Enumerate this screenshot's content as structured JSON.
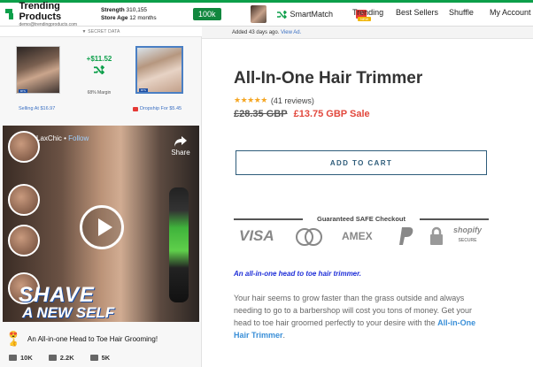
{
  "topbar": {
    "logo_title": "Trending Products",
    "logo_email": "demo@trendingproducts.com",
    "strength_label": "Strength",
    "strength_value": "310,155",
    "store_age_label": "Store Age",
    "store_age_value": "12 months",
    "score": "100k",
    "smartmatch_label": "SmartMatch",
    "notification_count": "6",
    "nav": [
      "Trending",
      "Best Sellers",
      "Shuffle",
      "My Account"
    ],
    "trending_badge": "NEW"
  },
  "left_panel": {
    "secret_label": "SECRET DATA",
    "margin_price": "+$11.52",
    "margin_pct": "68% Margin",
    "selling_label": "Selling At $16.97",
    "dropship_label": "Dropship For $5.45",
    "thumb_tag_1": "BTS",
    "thumb_tag_2": "BTS",
    "video": {
      "creator": "LaxChic",
      "follow": "Follow",
      "share": "Share",
      "headline_1": "SHAVE",
      "headline_2": "A NEW SELF"
    },
    "caption_emoji": "😍👍",
    "caption": "An All-in-one Head to Toe Hair Grooming!",
    "metrics": {
      "likes": "10K",
      "comments": "2.2K",
      "shares": "5K"
    }
  },
  "product": {
    "added_text": "Added 43 days ago.",
    "view_ad": "View Ad.",
    "title": "All-In-One Hair Trimmer",
    "stars": "★★★★★",
    "reviews": "(41 reviews)",
    "old_price": "£28.35 GBP",
    "sale_price": "£13.75 GBP Sale",
    "cart_button": "ADD TO CART",
    "checkout_label": "Guaranteed SAFE Checkout",
    "payment_methods": [
      "VISA",
      "AMEX",
      "shopify"
    ],
    "shopify_sub": "SECURE",
    "desc_title": "An all-in-one head to toe hair trimmer.",
    "desc_part1": "Your hair seems to grow faster than the grass outside and always needing to go to a barbershop will cost you tons of money. Get your head to toe hair groomed perfectly to your desire with the ",
    "desc_highlight": "All-in-One Hair Trimmer",
    "desc_end": "."
  },
  "colors": {
    "brand_green": "#0c9f4a",
    "sale_red": "#e2483d",
    "link_blue": "#3a6fc2",
    "cart_border": "#2e5c7a"
  }
}
